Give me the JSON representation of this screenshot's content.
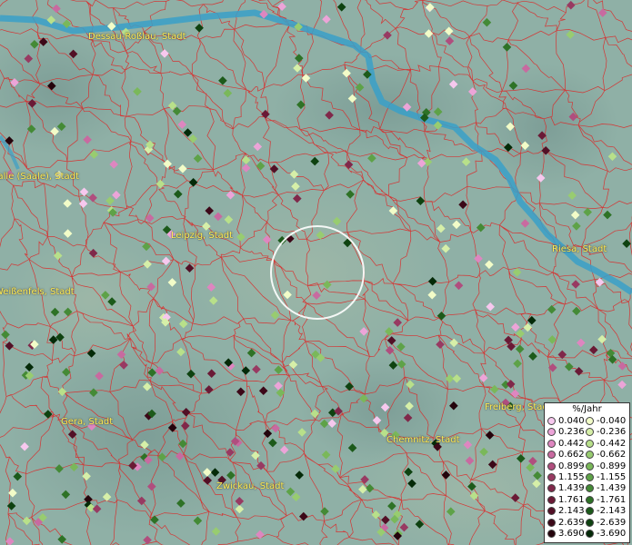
{
  "map": {
    "cities": [
      "Dessau-Roßlau, Stadt",
      "Halle (Saale), Stadt",
      "Leipzig, Stadt",
      "Weißenfels, Stadt",
      "Riesa, Stadt",
      "Gera, Stadt",
      "Chemnitz, Stadt",
      "Freiberg, Stadt",
      "Zwickau, Stadt"
    ],
    "river_color": "#3aa0c8",
    "border_color": "#e02020",
    "background_color": "#8fb0a6"
  },
  "legend": {
    "title": "%/Jahr",
    "positive": [
      {
        "label": "0.040",
        "color": "#f6c8ee"
      },
      {
        "label": "0.236",
        "color": "#eca4d8"
      },
      {
        "label": "0.442",
        "color": "#de86c0"
      },
      {
        "label": "0.662",
        "color": "#c86aa0"
      },
      {
        "label": "0.899",
        "color": "#b04e7e"
      },
      {
        "label": "1.155",
        "color": "#983a62"
      },
      {
        "label": "1.439",
        "color": "#80284a"
      },
      {
        "label": "1.761",
        "color": "#6a1a36"
      },
      {
        "label": "2.143",
        "color": "#521026"
      },
      {
        "label": "2.639",
        "color": "#3c0818"
      },
      {
        "label": "3.690",
        "color": "#24040c"
      }
    ],
    "negative": [
      {
        "label": "-0.040",
        "color": "#f2fcc8"
      },
      {
        "label": "-0.236",
        "color": "#d6efa8"
      },
      {
        "label": "-0.442",
        "color": "#b8e08a"
      },
      {
        "label": "-0.662",
        "color": "#98cc70"
      },
      {
        "label": "-0.899",
        "color": "#7ab85a"
      },
      {
        "label": "-1.155",
        "color": "#5ea248"
      },
      {
        "label": "-1.439",
        "color": "#448a36"
      },
      {
        "label": "-1.761",
        "color": "#2e7226"
      },
      {
        "label": "-2.143",
        "color": "#1c5a1a"
      },
      {
        "label": "-2.639",
        "color": "#0e4210"
      },
      {
        "label": "-3.690",
        "color": "#042a08"
      }
    ]
  }
}
